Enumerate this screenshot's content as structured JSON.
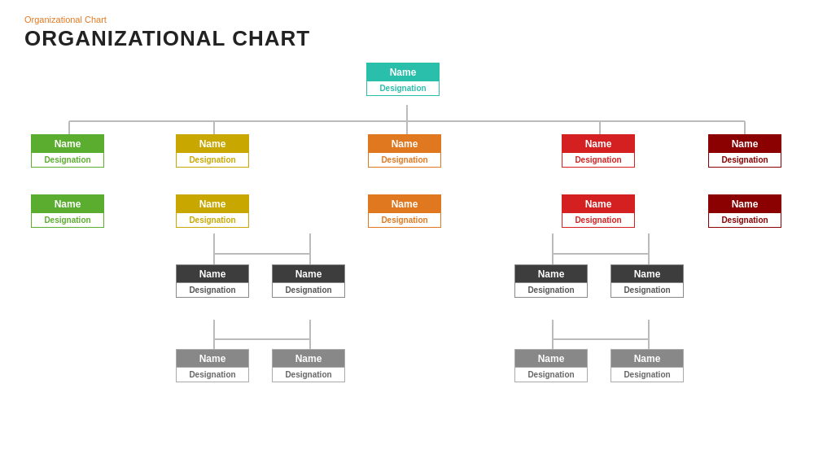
{
  "header": {
    "subtitle": "Organizational  Chart",
    "title": "ORGANIZATIONAL CHART"
  },
  "nodes": {
    "root": {
      "name": "Name",
      "desig": "Designation",
      "color": "teal"
    },
    "l1": [
      {
        "name": "Name",
        "desig": "Designation",
        "color": "green"
      },
      {
        "name": "Name",
        "desig": "Designation",
        "color": "yellow"
      },
      {
        "name": "Name",
        "desig": "Designation",
        "color": "orange"
      },
      {
        "name": "Name",
        "desig": "Designation",
        "color": "red"
      },
      {
        "name": "Name",
        "desig": "Designation",
        "color": "darkred"
      }
    ],
    "l2": [
      {
        "name": "Name",
        "desig": "Designation",
        "color": "green"
      },
      {
        "name": "Name",
        "desig": "Designation",
        "color": "yellow"
      },
      {
        "name": "Name",
        "desig": "Designation",
        "color": "orange"
      },
      {
        "name": "Name",
        "desig": "Designation",
        "color": "red"
      },
      {
        "name": "Name",
        "desig": "Designation",
        "color": "darkred"
      }
    ],
    "l3": [
      {
        "name": "Name",
        "desig": "Designation",
        "color": "darkgray"
      },
      {
        "name": "Name",
        "desig": "Designation",
        "color": "darkgray"
      },
      {
        "name": "Name",
        "desig": "Designation",
        "color": "darkgray"
      },
      {
        "name": "Name",
        "desig": "Designation",
        "color": "darkgray"
      }
    ],
    "l4": [
      {
        "name": "Name",
        "desig": "Designation",
        "color": "lightgray"
      },
      {
        "name": "Name",
        "desig": "Designation",
        "color": "lightgray"
      },
      {
        "name": "Name",
        "desig": "Designation",
        "color": "lightgray"
      },
      {
        "name": "Name",
        "desig": "Designation",
        "color": "lightgray"
      }
    ]
  }
}
